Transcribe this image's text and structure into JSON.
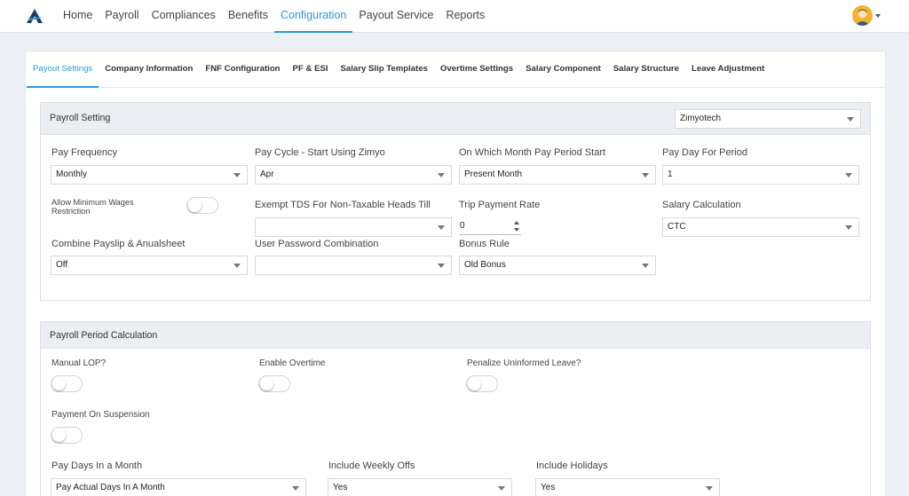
{
  "nav": {
    "items": [
      "Home",
      "Payroll",
      "Compliances",
      "Benefits",
      "Configuration",
      "Payout Service",
      "Reports"
    ],
    "active": "Configuration"
  },
  "tabs": {
    "items": [
      "Payout Settings",
      "Company Information",
      "FNF Configuration",
      "PF & ESI",
      "Salary Slip Templates",
      "Overtime Settings",
      "Salary Component",
      "Salary Structure",
      "Leave Adjustment"
    ],
    "active": "Payout Settings"
  },
  "payroll_setting": {
    "title": "Payroll Setting",
    "company": "Zimyotech",
    "pay_frequency": {
      "label": "Pay Frequency",
      "value": "Monthly"
    },
    "pay_cycle": {
      "label": "Pay Cycle - Start Using Zimyo",
      "value": "Apr"
    },
    "pay_period_start": {
      "label": "On Which Month Pay Period Start",
      "value": "Present Month"
    },
    "pay_day": {
      "label": "Pay Day For Period",
      "value": "1"
    },
    "min_wages": {
      "label": "Allow Minimum Wages Restriction",
      "on": false
    },
    "exempt_tds": {
      "label": "Exempt TDS For Non-Taxable Heads Till",
      "value": ""
    },
    "trip_rate": {
      "label": "Trip Payment Rate",
      "value": "0"
    },
    "salary_calc": {
      "label": "Salary Calculation",
      "value": "CTC"
    },
    "combine_payslip": {
      "label": "Combine Payslip & Anualsheet",
      "value": "Off"
    },
    "user_password": {
      "label": "User Password Combination",
      "value": ""
    },
    "bonus_rule": {
      "label": "Bonus Rule",
      "value": "Old Bonus"
    }
  },
  "period_calc": {
    "title": "Payroll Period Calculation",
    "manual_lop": {
      "label": "Manual LOP?",
      "on": false
    },
    "enable_overtime": {
      "label": "Enable Overtime",
      "on": false
    },
    "penalize_leave": {
      "label": "Penalize Uninformed Leave?",
      "on": false
    },
    "payment_suspension": {
      "label": "Payment On Suspension",
      "on": false
    },
    "pay_days": {
      "label": "Pay Days In a Month",
      "value": "Pay Actual Days In A Month"
    },
    "weekly_offs": {
      "label": "Include Weekly Offs",
      "value": "Yes"
    },
    "holidays": {
      "label": "Include Holidays",
      "value": "Yes"
    }
  },
  "colors": {
    "accent": "#2b9ad6",
    "panel_header": "#ebeef2"
  },
  "icons": {
    "logo": "app-logo-icon",
    "avatar": "user-avatar-icon"
  }
}
